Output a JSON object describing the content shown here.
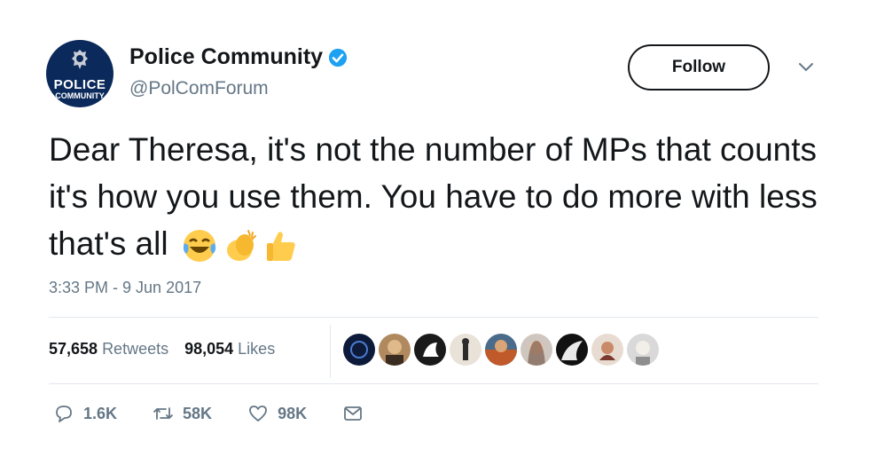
{
  "account": {
    "display_name": "Police Community",
    "handle": "@PolComForum",
    "avatar_text_top": "POLICE",
    "avatar_text_bottom": "COMMUNITY"
  },
  "follow_label": "Follow",
  "tweet": {
    "text": "Dear Theresa, it's not the number of MPs that counts it's how you use them. You have to do more with less that's all",
    "emojis": [
      "face-with-tears-of-joy",
      "clapping-hands",
      "thumbs-up"
    ],
    "timestamp": "3:33 PM - 9 Jun 2017"
  },
  "stats": {
    "retweets_count": "57,658",
    "retweets_label": "Retweets",
    "likes_count": "98,054",
    "likes_label": "Likes"
  },
  "likers": [
    "liker-1",
    "liker-2",
    "liker-3",
    "liker-4",
    "liker-5",
    "liker-6",
    "liker-7",
    "liker-8",
    "liker-9"
  ],
  "actions": {
    "reply_count": "1.6K",
    "retweet_count": "58K",
    "like_count": "98K"
  },
  "colors": {
    "text": "#14171a",
    "secondary": "#657786",
    "verified": "#1da1f2",
    "divider": "#e1e8ed",
    "avatar_bg": "#0b2a5b"
  }
}
